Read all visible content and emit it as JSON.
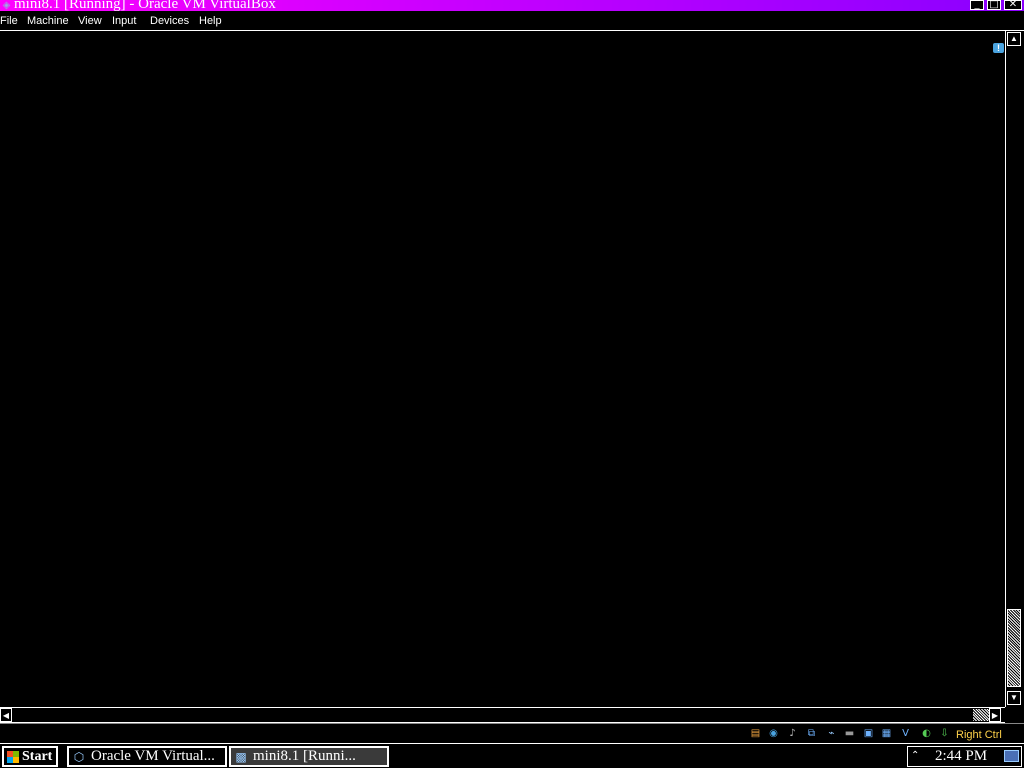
{
  "window": {
    "title": "mini8.1 [Running] - Oracle VM VirtualBox",
    "app_icon": "virtualbox-icon",
    "controls": {
      "minimize": "minimize-icon",
      "maximize": "maximize-icon",
      "close": "close-icon"
    }
  },
  "menubar": {
    "items": [
      {
        "label": "File"
      },
      {
        "label": "Machine"
      },
      {
        "label": "View"
      },
      {
        "label": "Input"
      },
      {
        "label": "Devices"
      },
      {
        "label": "Help"
      }
    ]
  },
  "vm_screen": {
    "background": "#000000",
    "notification_icon": "message-info-icon"
  },
  "status_bar": {
    "icons": [
      "hard-disk-icon",
      "optical-drive-icon",
      "audio-icon",
      "network-icon",
      "usb-icon",
      "shared-folders-icon",
      "display-icon",
      "video-capture-icon",
      "virtualization-icon",
      "mouse-integration-icon",
      "keyboard-capture-icon"
    ],
    "host_key": "Right Ctrl",
    "host_key_color": "#ffd24a"
  },
  "taskbar": {
    "start_label": "Start",
    "buttons": [
      {
        "label": "Oracle VM Virtual...",
        "icon": "virtualbox-manager-icon",
        "active": false
      },
      {
        "label": "mini8.1 [Runni...",
        "icon": "vm-window-icon",
        "active": true
      }
    ],
    "tray": {
      "expand_icon": "show-hidden-icons-icon",
      "clock": "2:44 PM",
      "show_desktop_icon": "show-desktop-icon"
    }
  },
  "colors": {
    "titlebar_start": "#ff00ff",
    "titlebar_end": "#8a00ff",
    "foreground": "#ffffff",
    "background": "#000000"
  }
}
